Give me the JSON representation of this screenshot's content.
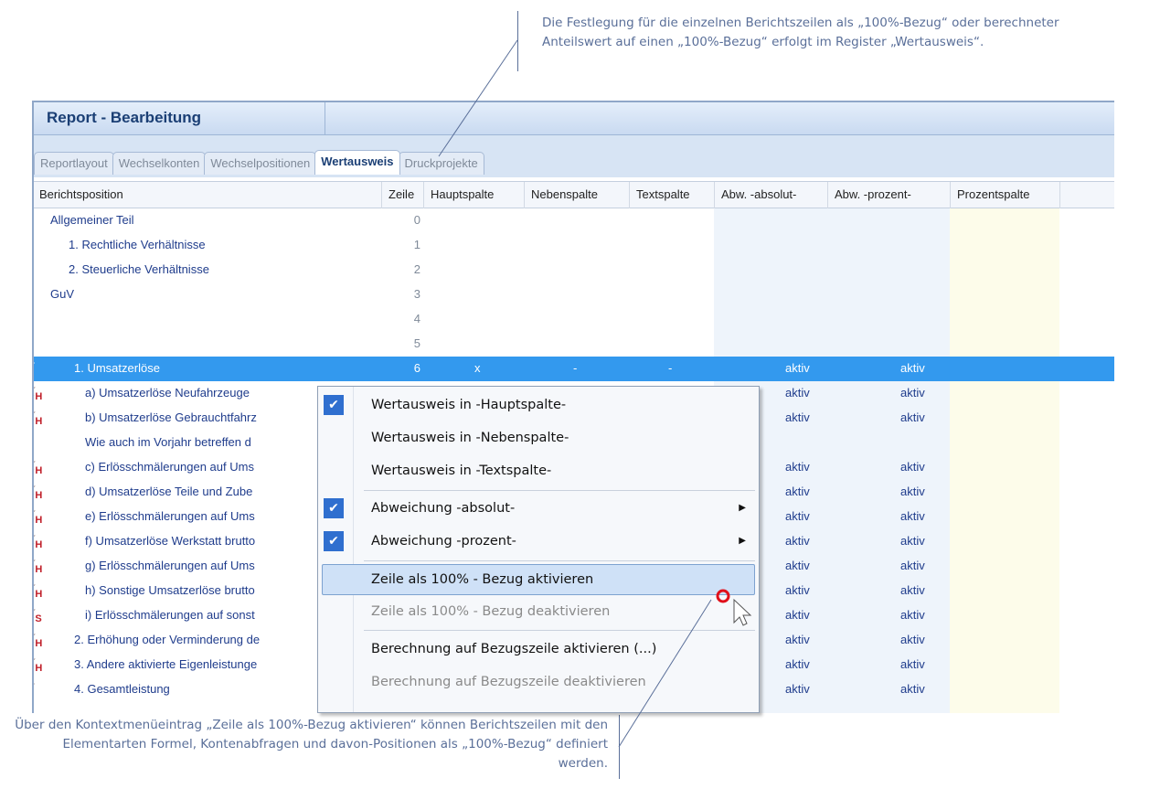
{
  "callouts": {
    "top": "Die Festlegung für die einzelnen Berichtszeilen als „100%-Bezug“ oder berechneter Anteilswert auf einen „100%-Bezug“ erfolgt im Register „Wertausweis“.",
    "bottom": "Über den Kontextmenüeintrag „Zeile als 100%-Bezug aktivieren“ können Berichtszeilen mit den Elementarten Formel, Kontenabfragen und davon-Positionen als „100%-Bezug“ definiert werden."
  },
  "window": {
    "title": "Report - Bearbeitung"
  },
  "tabs": [
    {
      "label": "Reportlayout",
      "active": false
    },
    {
      "label": "Wechselkonten",
      "active": false
    },
    {
      "label": "Wechselpositionen",
      "active": false
    },
    {
      "label": "Wertausweis",
      "active": true
    },
    {
      "label": "Druckprojekte",
      "active": false
    }
  ],
  "columns": {
    "berichtsposition": "Berichtsposition",
    "zeile": "Zeile",
    "hauptspalte": "Hauptspalte",
    "nebenspalte": "Nebenspalte",
    "textspalte": "Textspalte",
    "abw_absolut": "Abw. -absolut-",
    "abw_prozent": "Abw. -prozent-",
    "prozentspalte": "Prozentspalte"
  },
  "rows": [
    {
      "icon": "",
      "sub": "",
      "label": "Allgemeiner Teil",
      "zeile": "0",
      "haupt": "",
      "neben": "",
      "text": "",
      "abs": "",
      "proz": ""
    },
    {
      "icon": "",
      "sub": "",
      "label": "1. Rechtliche Verhältnisse",
      "zeile": "1",
      "haupt": "",
      "neben": "",
      "text": "",
      "abs": "",
      "proz": ""
    },
    {
      "icon": "",
      "sub": "",
      "label": "2. Steuerliche Verhältnisse",
      "zeile": "2",
      "haupt": "",
      "neben": "",
      "text": "",
      "abs": "",
      "proz": ""
    },
    {
      "icon": "",
      "sub": "",
      "label": "GuV",
      "zeile": "3",
      "haupt": "",
      "neben": "",
      "text": "",
      "abs": "",
      "proz": ""
    },
    {
      "icon": "",
      "sub": "",
      "label": "",
      "zeile": "4",
      "haupt": "",
      "neben": "",
      "text": "",
      "abs": "",
      "proz": ""
    },
    {
      "icon": "",
      "sub": "",
      "label": "",
      "zeile": "5",
      "haupt": "",
      "neben": "",
      "text": "",
      "abs": "",
      "proz": ""
    },
    {
      "icon": "Σ",
      "sub": "",
      "label": "1. Umsatzerlöse",
      "zeile": "6",
      "haupt": "x",
      "neben": "-",
      "text": "-",
      "abs": "aktiv",
      "proz": "aktiv"
    },
    {
      "icon": "K",
      "sub": "H",
      "label": "a) Umsatzerlöse Neufahrzeuge",
      "zeile": "",
      "haupt": "",
      "neben": "",
      "text": "",
      "abs": "aktiv",
      "proz": "aktiv"
    },
    {
      "icon": "K",
      "sub": "H",
      "label": "b) Umsatzerlöse Gebrauchtfahrz",
      "zeile": "",
      "haupt": "",
      "neben": "",
      "text": "",
      "abs": "aktiv",
      "proz": "aktiv"
    },
    {
      "icon": "",
      "sub": "",
      "label": "Wie auch im Vorjahr betreffen d",
      "zeile": "",
      "haupt": "",
      "neben": "",
      "text": "",
      "abs": "",
      "proz": ""
    },
    {
      "icon": "K",
      "sub": "H",
      "label": "c) Erlösschmälerungen auf Ums",
      "zeile": "",
      "haupt": "",
      "neben": "",
      "text": "",
      "abs": "aktiv",
      "proz": "aktiv"
    },
    {
      "icon": "K",
      "sub": "H",
      "label": "d) Umsatzerlöse Teile und Zube",
      "zeile": "",
      "haupt": "",
      "neben": "",
      "text": "",
      "abs": "aktiv",
      "proz": "aktiv"
    },
    {
      "icon": "K",
      "sub": "H",
      "label": "e) Erlösschmälerungen auf Ums",
      "zeile": "",
      "haupt": "",
      "neben": "",
      "text": "",
      "abs": "aktiv",
      "proz": "aktiv"
    },
    {
      "icon": "K",
      "sub": "H",
      "label": "f) Umsatzerlöse Werkstatt brutto",
      "zeile": "",
      "haupt": "",
      "neben": "",
      "text": "",
      "abs": "aktiv",
      "proz": "aktiv"
    },
    {
      "icon": "K",
      "sub": "H",
      "label": "g) Erlösschmälerungen auf Ums",
      "zeile": "",
      "haupt": "",
      "neben": "",
      "text": "",
      "abs": "aktiv",
      "proz": "aktiv"
    },
    {
      "icon": "K",
      "sub": "H",
      "label": "h) Sonstige Umsatzerlöse brutto",
      "zeile": "",
      "haupt": "",
      "neben": "",
      "text": "",
      "abs": "aktiv",
      "proz": "aktiv"
    },
    {
      "icon": "K",
      "sub": "S",
      "label": "i) Erlösschmälerungen auf sonst",
      "zeile": "",
      "haupt": "",
      "neben": "",
      "text": "",
      "abs": "aktiv",
      "proz": "aktiv"
    },
    {
      "icon": "K",
      "sub": "H",
      "label": "2. Erhöhung oder Verminderung de",
      "zeile": "",
      "haupt": "",
      "neben": "",
      "text": "",
      "abs": "aktiv",
      "proz": "aktiv"
    },
    {
      "icon": "K",
      "sub": "H",
      "label": "3. Andere aktivierte Eigenleistunge",
      "zeile": "",
      "haupt": "",
      "neben": "",
      "text": "",
      "abs": "aktiv",
      "proz": "aktiv"
    },
    {
      "icon": "Σ",
      "sub": "",
      "label": "4. Gesamtleistung",
      "zeile": "",
      "haupt": "",
      "neben": "",
      "text": "",
      "abs": "aktiv",
      "proz": "aktiv"
    }
  ],
  "context_menu": {
    "items": [
      {
        "label": "Wertausweis in  -Hauptspalte-",
        "checked": true,
        "submenu": false,
        "disabled": false,
        "hover": false
      },
      {
        "label": "Wertausweis in  -Nebenspalte-",
        "checked": false,
        "submenu": false,
        "disabled": false,
        "hover": false
      },
      {
        "label": "Wertausweis in  -Textspalte-",
        "checked": false,
        "submenu": false,
        "disabled": false,
        "hover": false
      },
      {
        "label": "Abweichung  -absolut-",
        "checked": true,
        "submenu": true,
        "disabled": false,
        "hover": false
      },
      {
        "label": "Abweichung  -prozent-",
        "checked": true,
        "submenu": true,
        "disabled": false,
        "hover": false
      },
      {
        "label": "Zeile als 100% - Bezug aktivieren",
        "checked": false,
        "submenu": false,
        "disabled": false,
        "hover": true
      },
      {
        "label": "Zeile als 100% - Bezug deaktivieren",
        "checked": false,
        "submenu": false,
        "disabled": true,
        "hover": false
      },
      {
        "label": "Berechnung auf Bezugszeile aktivieren (...)",
        "checked": false,
        "submenu": false,
        "disabled": false,
        "hover": false
      },
      {
        "label": "Berechnung auf Bezugszeile deaktivieren",
        "checked": false,
        "submenu": false,
        "disabled": true,
        "hover": false
      }
    ]
  },
  "colors": {
    "selection": "#3399ee",
    "accent": "#1b3f75",
    "marker": "#e0101a"
  }
}
